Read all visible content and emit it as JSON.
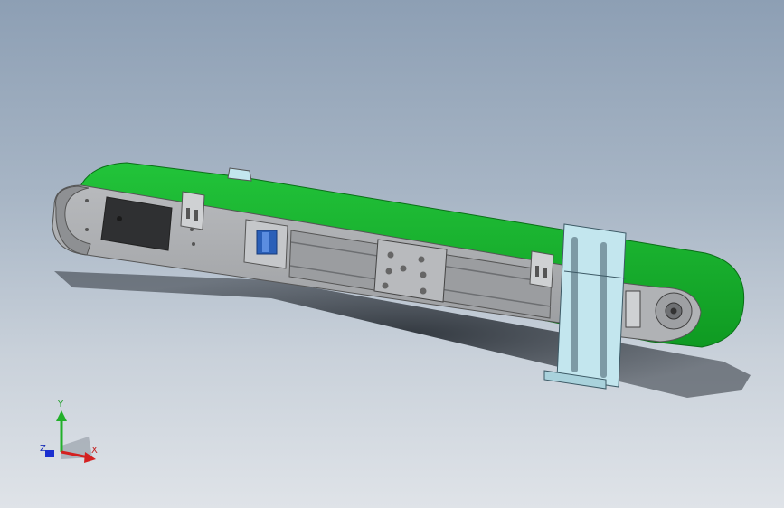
{
  "viewport": {
    "background_top": "#8d9fb4",
    "background_bottom": "#dfe3e8"
  },
  "model": {
    "belt_color": "#12b52a",
    "frame_color": "#a8aaad",
    "bracket_color": "#c3e6ee",
    "motor_panel_color": "#3a3a3a"
  },
  "triad": {
    "x_label": "X",
    "y_label": "Y",
    "z_label": "Z",
    "x_color": "#d42020",
    "y_color": "#22b02a",
    "z_color": "#1a2fd0"
  }
}
